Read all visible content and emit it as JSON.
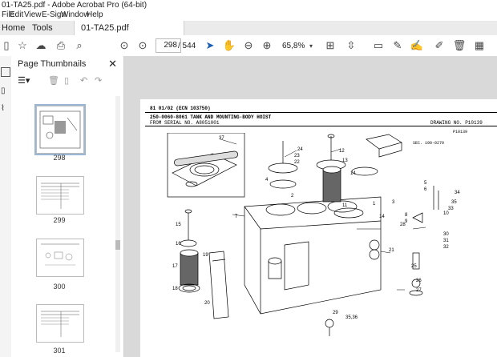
{
  "window": {
    "title": "01-TA25.pdf - Adobe Acrobat Pro (64-bit)"
  },
  "menu": [
    "File",
    "Edit",
    "View",
    "E-Sign",
    "Window",
    "Help"
  ],
  "tabs": {
    "home": "Home",
    "tools": "Tools",
    "document": "01-TA25.pdf"
  },
  "toolbar": {
    "current_page": "298",
    "page_total": "/ 544",
    "zoom": "65,8%"
  },
  "thumbnails": {
    "title": "Page Thumbnails",
    "pages": [
      "298",
      "299",
      "300",
      "301"
    ]
  },
  "document": {
    "header_line": "81 01/02 (ECN 103750)",
    "title_line": "250-0060-8061 TANK AND MOUNTING-BODY HOIST",
    "serial_line": "FROM SERIAL NO. A8051001",
    "drawing_no": "DRAWING NO. P10139",
    "figure_ref": "P10139",
    "callout_sec": "SEC. 190-0270",
    "callouts": [
      "37",
      "24",
      "23",
      "22",
      "12",
      "13",
      "14",
      "11",
      "5",
      "6",
      "7",
      "2",
      "1",
      "3",
      "4",
      "8",
      "9",
      "10",
      "33",
      "34",
      "35",
      "14",
      "15",
      "16",
      "17",
      "18",
      "19",
      "20",
      "21",
      "25",
      "26",
      "27",
      "28",
      "29",
      "30",
      "31",
      "32",
      "35,36"
    ]
  }
}
